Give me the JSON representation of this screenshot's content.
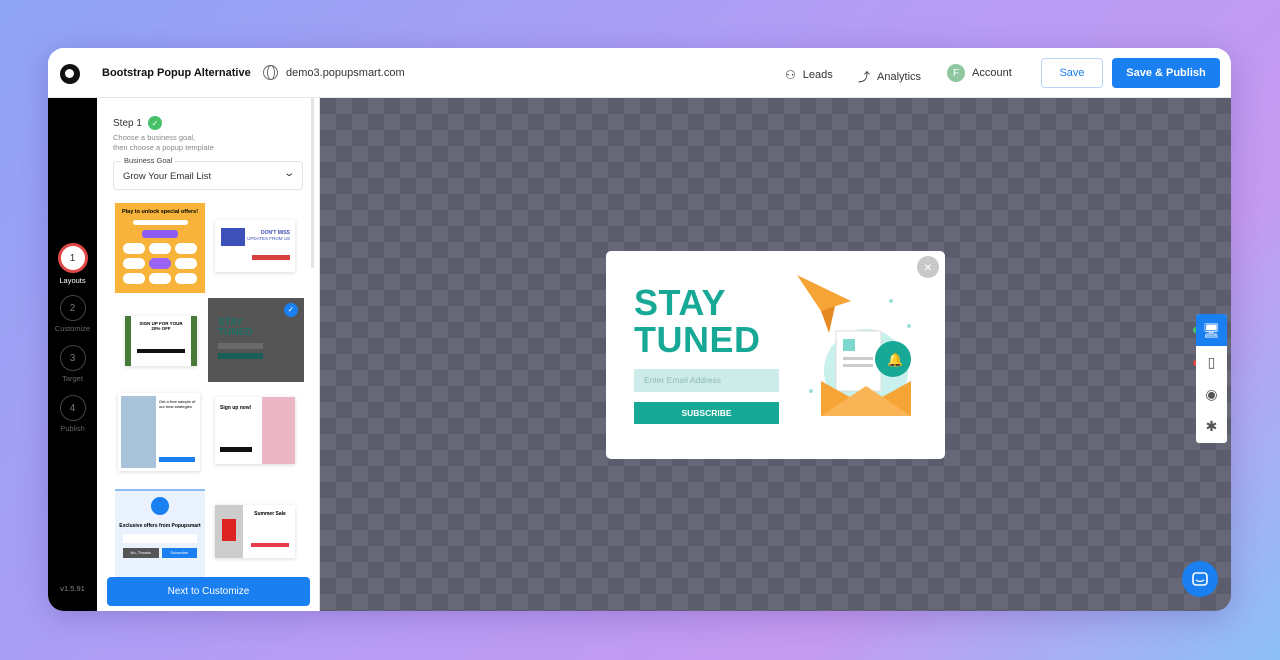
{
  "header": {
    "title": "Bootstrap Popup Alternative",
    "domain": "demo3.popupsmart.com",
    "leads": "Leads",
    "analytics": "Analytics",
    "account": "Account",
    "account_initial": "F",
    "save": "Save",
    "save_publish": "Save & Publish"
  },
  "steps": [
    {
      "num": "1",
      "label": "Layouts"
    },
    {
      "num": "2",
      "label": "Customize"
    },
    {
      "num": "3",
      "label": "Target"
    },
    {
      "num": "4",
      "label": "Publish"
    }
  ],
  "version": "v1.5.91",
  "panel": {
    "step_title": "Step 1",
    "desc1": "Choose a business goal,",
    "desc2": "then choose a popup template",
    "goal_label": "Business Goal",
    "goal_value": "Grow Your Email List",
    "next": "Next to Customize"
  },
  "templates": [
    {
      "title": "Play to unlock special offers!"
    },
    {
      "title": "DON'T MISS",
      "subtitle": "UPDATES FROM US"
    },
    {
      "title": "SIGN UP FOR YOUR 20% OFF"
    },
    {
      "title": "STAY TUNED",
      "selected": true
    },
    {
      "title": "Get a free sample of our best strategies"
    },
    {
      "title": "Sign up now!"
    },
    {
      "title": "Exclusive offers from Popupsmart",
      "btn1": "No, Thanks",
      "btn2": "Subscribe"
    },
    {
      "title": "Summer Sale"
    }
  ],
  "popup": {
    "line1": "STAY",
    "line2": "TUNED",
    "email_placeholder": "Enter Email Address",
    "subscribe": "SUBSCRIBE",
    "colors": {
      "accent": "#18a896",
      "envelope": "#f6a436"
    }
  },
  "toolbar": {
    "items": [
      "desktop-icon",
      "mobile-icon",
      "preview-icon",
      "debug-icon"
    ],
    "active": "desktop"
  },
  "colors": {
    "primary": "#1a7ff0",
    "step_active": "#e04848"
  }
}
